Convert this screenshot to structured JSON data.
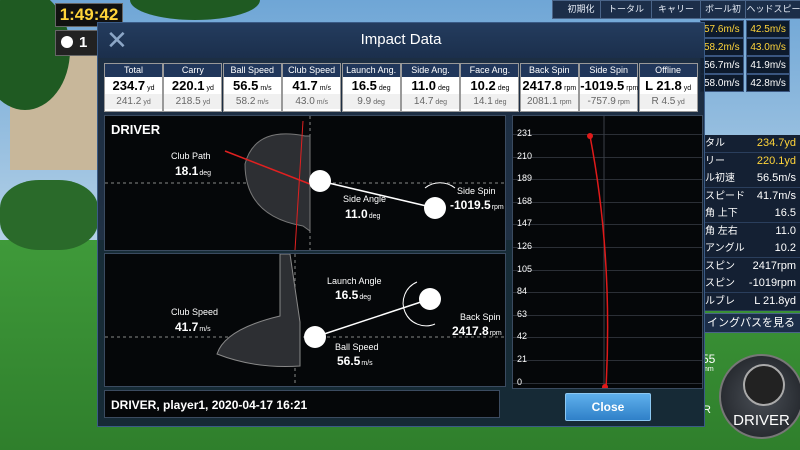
{
  "timer": "1:49:42",
  "ball_count": "1",
  "top_tabs": [
    "初期化",
    "トータル",
    "キャリー",
    "ボール初速",
    "ヘッドスピード"
  ],
  "speed_rows": [
    {
      "ball": "57.6m/s",
      "head": "42.5m/s"
    },
    {
      "ball": "58.2m/s",
      "head": "43.0m/s"
    },
    {
      "ball": "56.7m/s",
      "head": "41.9m/s"
    },
    {
      "ball": "58.0m/s",
      "head": "42.8m/s"
    }
  ],
  "side_data": [
    {
      "label": "タル",
      "value": "234.7yd",
      "highlight": true
    },
    {
      "label": "リー",
      "value": "220.1yd",
      "highlight": true
    },
    {
      "label": "ル初速",
      "value": "56.5m/s",
      "highlight": false
    },
    {
      "label": "スピード",
      "value": "41.7m/s",
      "highlight": false
    },
    {
      "label": "角 上下",
      "value": "16.5",
      "highlight": false
    },
    {
      "label": "角 左右",
      "value": "11.0",
      "highlight": false
    },
    {
      "label": "アングル",
      "value": "10.2",
      "highlight": false
    },
    {
      "label": "スピン",
      "value": "2417rpm",
      "highlight": false
    },
    {
      "label": "スピン",
      "value": "-1019rpm",
      "highlight": false
    },
    {
      "label": "ルブレ",
      "value": "L 21.8yd",
      "highlight": false
    }
  ],
  "swing_path_button": "イングパスを見る",
  "club_button": "DRIVER",
  "club_button_number": "55",
  "club_button_unit": "mm",
  "club_button_r": "R",
  "modal": {
    "title": "Impact Data",
    "columns": [
      {
        "header": "Total",
        "v1": "234.7",
        "u1": "yd",
        "v2": "241.2",
        "u2": "yd"
      },
      {
        "header": "Carry",
        "v1": "220.1",
        "u1": "yd",
        "v2": "218.5",
        "u2": "yd"
      },
      {
        "header": "Ball Speed",
        "v1": "56.5",
        "u1": "m/s",
        "v2": "58.2",
        "u2": "m/s"
      },
      {
        "header": "Club Speed",
        "v1": "41.7",
        "u1": "m/s",
        "v2": "43.0",
        "u2": "m/s"
      },
      {
        "header": "Launch Ang.",
        "v1": "16.5",
        "u1": "deg",
        "v2": "9.9",
        "u2": "deg"
      },
      {
        "header": "Side Ang.",
        "v1": "11.0",
        "u1": "deg",
        "v2": "14.7",
        "u2": "deg"
      },
      {
        "header": "Face Ang.",
        "v1": "10.2",
        "u1": "deg",
        "v2": "14.1",
        "u2": "deg"
      },
      {
        "header": "Back Spin",
        "v1": "2417.8",
        "u1": "rpm",
        "v2": "2081.1",
        "u2": "rpm"
      },
      {
        "header": "Side Spin",
        "v1": "-1019.5",
        "u1": "rpm",
        "v2": "-757.9",
        "u2": "rpm"
      },
      {
        "header": "Offline",
        "v1": "L 21.8",
        "u1": "yd",
        "v2": "R 4.5",
        "u2": "yd"
      }
    ],
    "top_panel": {
      "title": "DRIVER",
      "club_path_label": "Club Path",
      "club_path_value": "18.1",
      "club_path_unit": "deg",
      "side_angle_label": "Side Angle",
      "side_angle_value": "11.0",
      "side_angle_unit": "deg",
      "side_spin_label": "Side Spin",
      "side_spin_value": "-1019.5",
      "side_spin_unit": "rpm"
    },
    "bottom_panel": {
      "launch_angle_label": "Launch Angle",
      "launch_angle_value": "16.5",
      "launch_angle_unit": "deg",
      "back_spin_label": "Back Spin",
      "back_spin_value": "2417.8",
      "back_spin_unit": "rpm",
      "club_speed_label": "Club Speed",
      "club_speed_value": "41.7",
      "club_speed_unit": "m/s",
      "ball_speed_label": "Ball Speed",
      "ball_speed_value": "56.5",
      "ball_speed_unit": "m/s"
    },
    "trajectory_ticks": [
      "231",
      "210",
      "189",
      "168",
      "147",
      "126",
      "105",
      "84",
      "63",
      "42",
      "21",
      "0"
    ],
    "footer": "DRIVER, player1, 2020-04-17 16:21",
    "close_button": "Close"
  },
  "colors": {
    "accent": "#3d8fd6",
    "highlight": "#ffd43a",
    "trajectory": "#e01a1a"
  }
}
